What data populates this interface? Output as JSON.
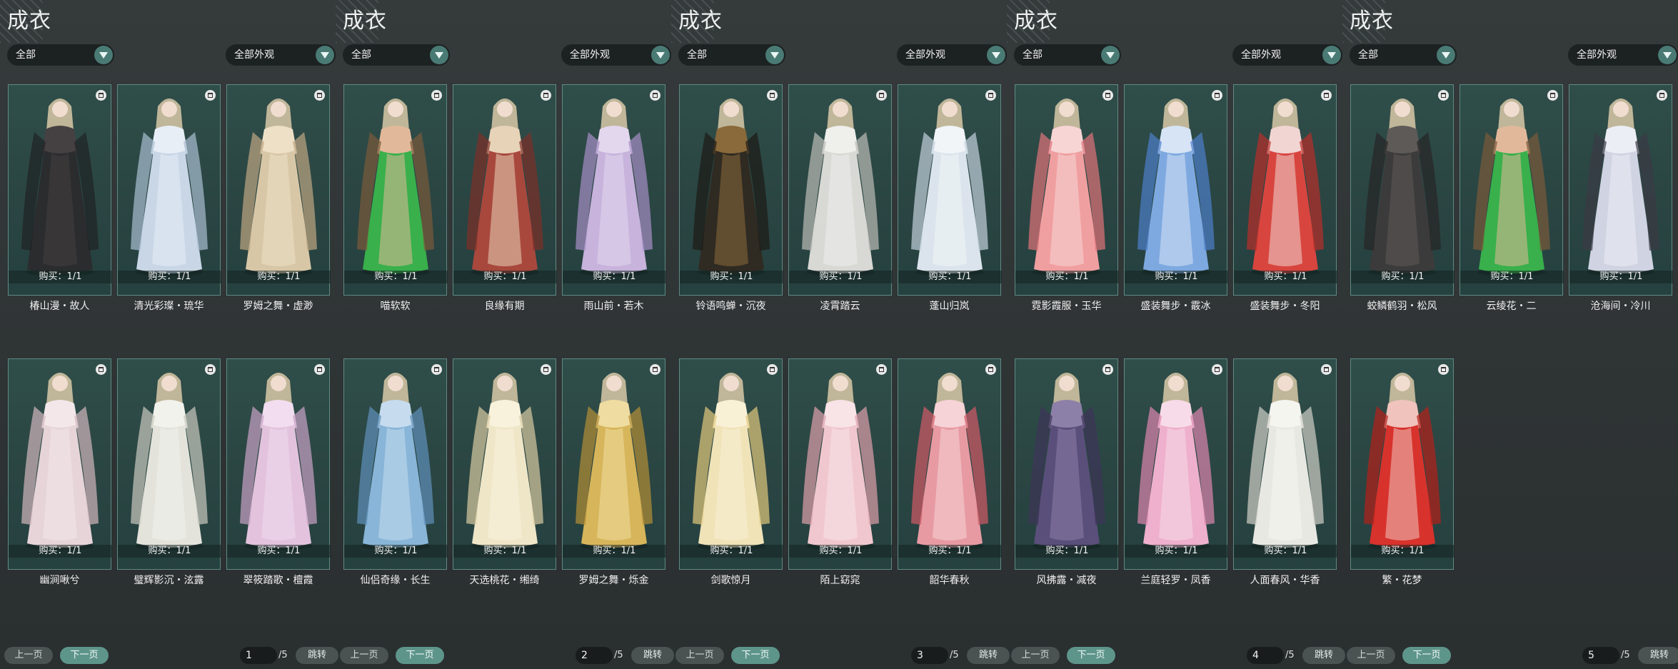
{
  "panel_title": "成衣",
  "filter_category": "全部",
  "filter_appearance": "全部外观",
  "buy_text": "购买：1/1",
  "pagination": {
    "prev_label": "上一页",
    "next_label": "下一页",
    "jump_label": "跳转",
    "total_label": "/5"
  },
  "pages": [
    {
      "page": "1",
      "items": [
        {
          "name": "椿山漫・故人",
          "palette": [
            "#2a2c2e",
            "#454042",
            "#1f2224"
          ]
        },
        {
          "name": "清光彩璨・琉华",
          "palette": [
            "#c8d6e6",
            "#e8eef6",
            "#a9bdd2"
          ]
        },
        {
          "name": "罗姆之舞・虚渺",
          "palette": [
            "#d8c7a6",
            "#ede0c6",
            "#bfa783"
          ]
        },
        {
          "name": "幽涧啾兮",
          "palette": [
            "#e6d4d8",
            "#f3e7ea",
            "#d1b6bd"
          ]
        },
        {
          "name": "璧辉影沉・泫露",
          "palette": [
            "#e3e3dc",
            "#f2f2ec",
            "#c9c9bf"
          ]
        },
        {
          "name": "翠筱踏歌・檀霞",
          "palette": [
            "#e2c2dc",
            "#f1ddef",
            "#c9a3c6"
          ]
        }
      ]
    },
    {
      "page": "2",
      "items": [
        {
          "name": "喵软软",
          "palette": [
            "#39b04b",
            "#e1b99a",
            "#7a5a3a"
          ]
        },
        {
          "name": "良缘有期",
          "palette": [
            "#a8483d",
            "#e7d3b8",
            "#7e2f28"
          ]
        },
        {
          "name": "雨山前・若木",
          "palette": [
            "#c7b3dc",
            "#e3d7ee",
            "#a78fc6"
          ]
        },
        {
          "name": "仙侣奇缘・长生",
          "palette": [
            "#88b5d8",
            "#c6dcee",
            "#5f90ba"
          ]
        },
        {
          "name": "天选桃花・缃绮",
          "palette": [
            "#efe6c8",
            "#f8f2dc",
            "#d9cba1"
          ]
        },
        {
          "name": "罗姆之舞・烁金",
          "palette": [
            "#d7b55a",
            "#efdca0",
            "#b38f36"
          ]
        }
      ]
    },
    {
      "page": "3",
      "items": [
        {
          "name": "铃语鸣蝉・沉夜",
          "palette": [
            "#2f2a22",
            "#8a6a3a",
            "#1d1a15"
          ]
        },
        {
          "name": "凌霄踏云",
          "palette": [
            "#d8d8d4",
            "#efefec",
            "#bcbcb6"
          ]
        },
        {
          "name": "蓬山归岚",
          "palette": [
            "#dbe4ec",
            "#f1f5f8",
            "#c3d0dc"
          ]
        },
        {
          "name": "剑歌惊月",
          "palette": [
            "#f0e3b8",
            "#f9f1d6",
            "#e1c77c"
          ]
        },
        {
          "name": "陌上窈窕",
          "palette": [
            "#f0c7ce",
            "#f8e3e7",
            "#de9fab"
          ]
        },
        {
          "name": "韶华春秋",
          "palette": [
            "#e79aa2",
            "#f6d3d6",
            "#d15a66"
          ]
        }
      ]
    },
    {
      "page": "4",
      "items": [
        {
          "name": "霓影霞服・玉华",
          "palette": [
            "#f09fa0",
            "#f7d5d5",
            "#df7379"
          ]
        },
        {
          "name": "盛装舞步・霰冰",
          "palette": [
            "#7ea9e0",
            "#d6e4f6",
            "#4d7fca"
          ]
        },
        {
          "name": "盛装舞步・冬阳",
          "palette": [
            "#d8453f",
            "#f1d5d2",
            "#b82e29"
          ]
        },
        {
          "name": "风拂露・减夜",
          "palette": [
            "#5a4f7a",
            "#8c80a8",
            "#3d3558"
          ]
        },
        {
          "name": "兰庭轻罗・凤香",
          "palette": [
            "#eeb0cc",
            "#f8dbe8",
            "#dd86ae"
          ]
        },
        {
          "name": "人面春风・华香",
          "palette": [
            "#e8e8e2",
            "#f5f5f0",
            "#cfcfc6"
          ]
        }
      ]
    },
    {
      "page": "5",
      "items": [
        {
          "name": "蛟鳞鹤羽・松风",
          "palette": [
            "#3c3b3b",
            "#5d5a58",
            "#262525"
          ]
        },
        {
          "name": "云绫花・二",
          "palette": [
            "#39b04b",
            "#e1b99a",
            "#7a5a3a"
          ]
        },
        {
          "name": "沧海间・冷川",
          "palette": [
            "#cfd3e2",
            "#eceef5",
            "#3a3a44"
          ]
        },
        {
          "name": "繁・花梦",
          "palette": [
            "#d8322c",
            "#f0c3bd",
            "#b51f1a"
          ]
        }
      ]
    }
  ]
}
